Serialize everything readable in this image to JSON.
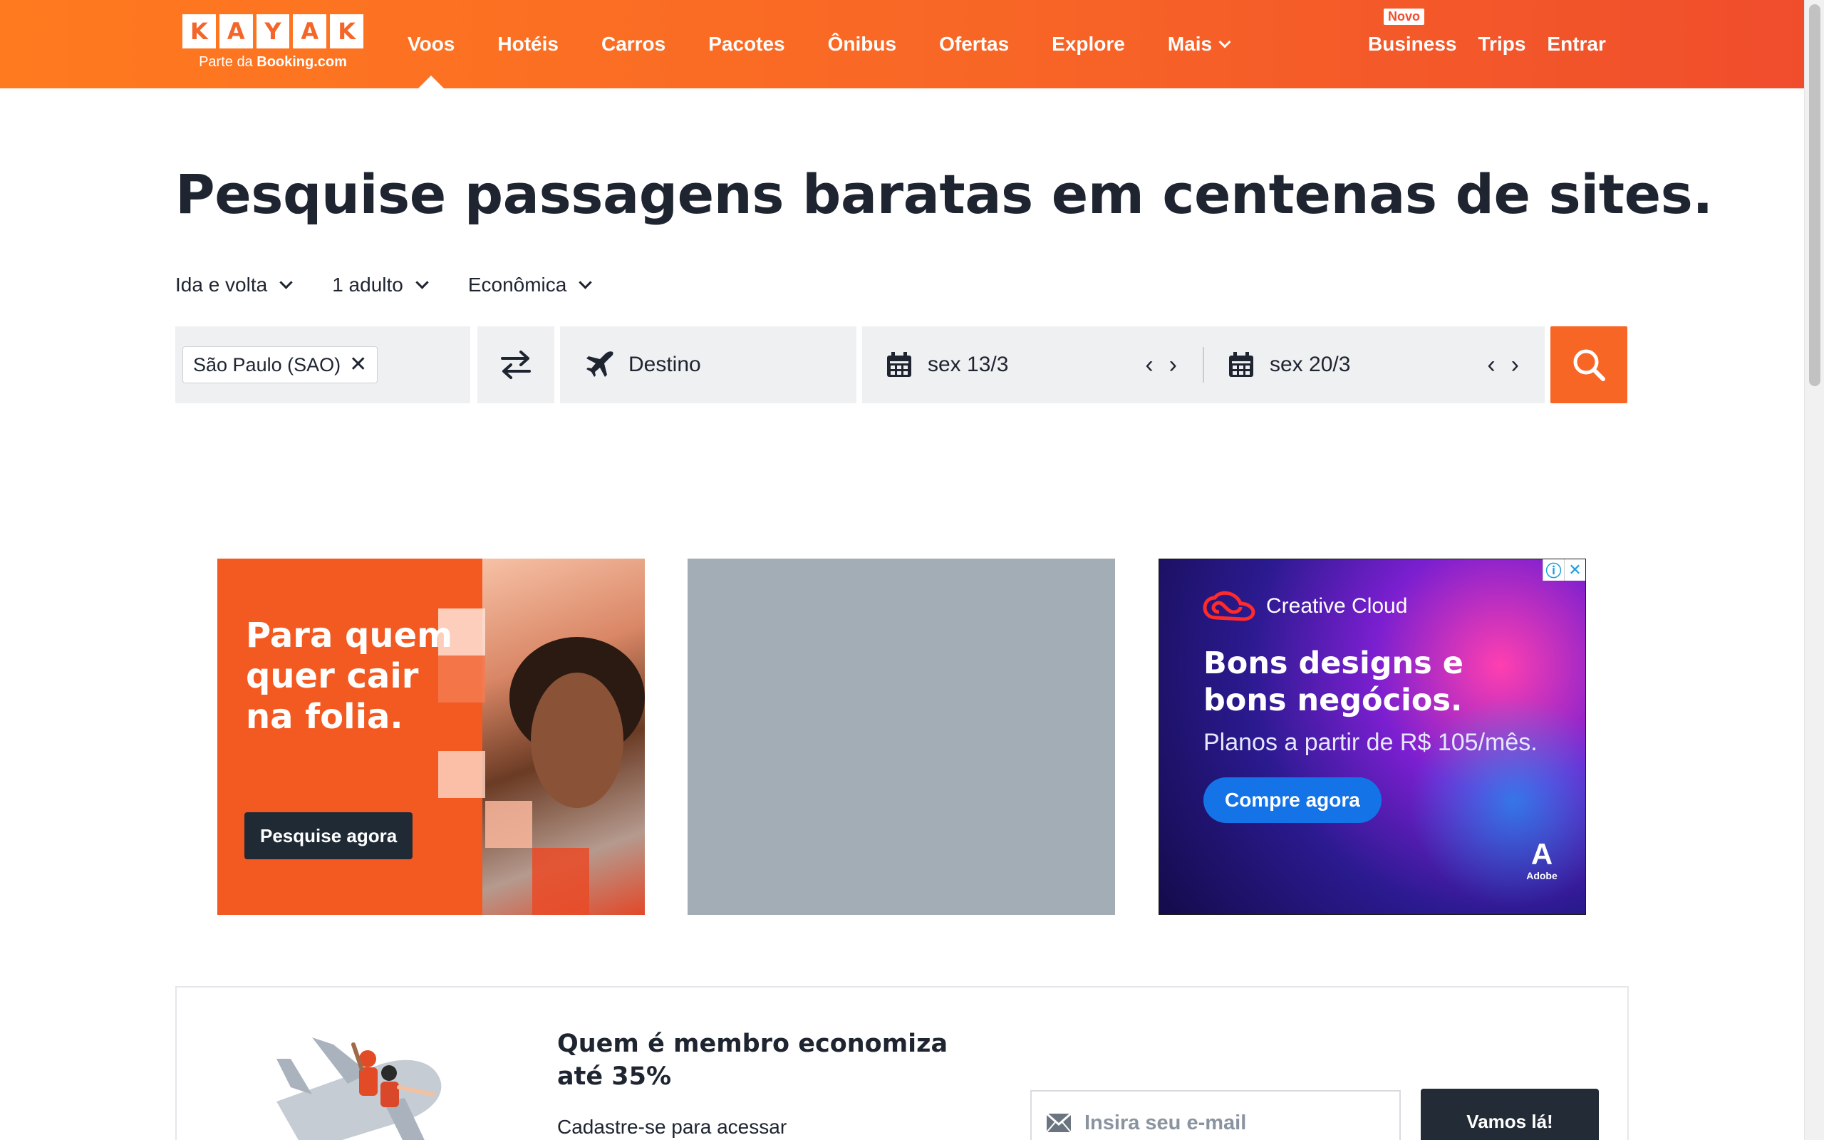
{
  "header": {
    "logo_letters": [
      "K",
      "A",
      "Y",
      "A",
      "K"
    ],
    "logo_sub_prefix": "Parte da",
    "logo_sub_brand": "Booking.com",
    "nav": [
      "Voos",
      "Hotéis",
      "Carros",
      "Pacotes",
      "Ônibus",
      "Ofertas",
      "Explore",
      "Mais"
    ],
    "active_nav": "Voos",
    "right": {
      "business_badge": "Novo",
      "business": "Business",
      "trips": "Trips",
      "signin": "Entrar"
    },
    "colors": {
      "accent": "#f86626",
      "header_gradient_start": "#ff7a1f",
      "header_gradient_end": "#f04d2c"
    }
  },
  "hero": {
    "title": "Pesquise passagens baratas em centenas de sites."
  },
  "search": {
    "trip_type": "Ida e volta",
    "travelers": "1 adulto",
    "cabin": "Econômica",
    "origin_chip": "São Paulo (SAO)",
    "destination_placeholder": "Destino",
    "depart_date": "sex 13/3",
    "return_date": "sex 20/3",
    "icons": {
      "swap": "swap-arrows-icon",
      "destination": "airplane-icon",
      "date": "calendar-icon",
      "submit": "search-icon"
    }
  },
  "ads": {
    "ad1": {
      "text": "Para quem quer cair na folia.",
      "button": "Pesquise agora"
    },
    "ad3": {
      "brand": "Creative Cloud",
      "headline": "Bons designs e bons negócios.",
      "subline": "Planos a partir de R$ 105/mês.",
      "button": "Compre agora",
      "footer_brand": "Adobe"
    }
  },
  "member": {
    "title": "Quem é membro economiza até 35%",
    "subtitle": "Cadastre-se para acessar",
    "email_placeholder": "Insira seu e-mail",
    "button": "Vamos lá!"
  }
}
